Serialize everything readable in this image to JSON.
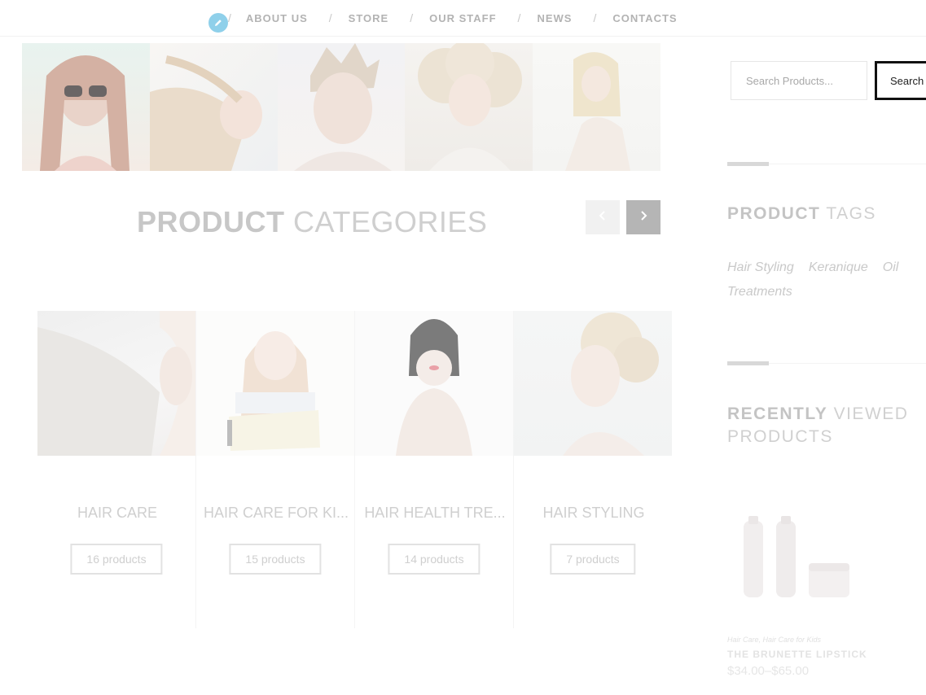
{
  "nav": {
    "items": [
      "ABOUT US",
      "STORE",
      "OUR STAFF",
      "NEWS",
      "CONTACTS"
    ],
    "separator": "/"
  },
  "gallery": {
    "images": [
      "woman-sunglasses",
      "woman-long-hair",
      "man-styled-hair",
      "woman-blonde-curls",
      "woman-sitting"
    ]
  },
  "categories_section": {
    "title_strong": "PRODUCT",
    "title_light": "CATEGORIES",
    "items": [
      {
        "name": "HAIR CARE",
        "count": "16 products"
      },
      {
        "name": "HAIR CARE FOR KI...",
        "count": "15 products"
      },
      {
        "name": "HAIR HEALTH TRE...",
        "count": "14 products"
      },
      {
        "name": "HAIR STYLING",
        "count": "7 products"
      }
    ]
  },
  "sidebar": {
    "search": {
      "placeholder": "Search Products...",
      "button": "Search"
    },
    "tags": {
      "title_strong": "PRODUCT",
      "title_light": "TAGS",
      "items": [
        "Hair Styling",
        "Keranique",
        "Oil",
        "Treatments"
      ]
    },
    "recent": {
      "title_strong": "RECENTLY",
      "title_light": "VIEWED PRODUCTS",
      "product": {
        "categories": "Hair Care, Hair Care for Kids",
        "name": "THE BRUNETTE LIPSTICK",
        "price": "$34.00–$65.00"
      }
    }
  },
  "colors": {
    "accent_badge": "#8fd0ea",
    "muted_text": "#cfcfcf"
  }
}
